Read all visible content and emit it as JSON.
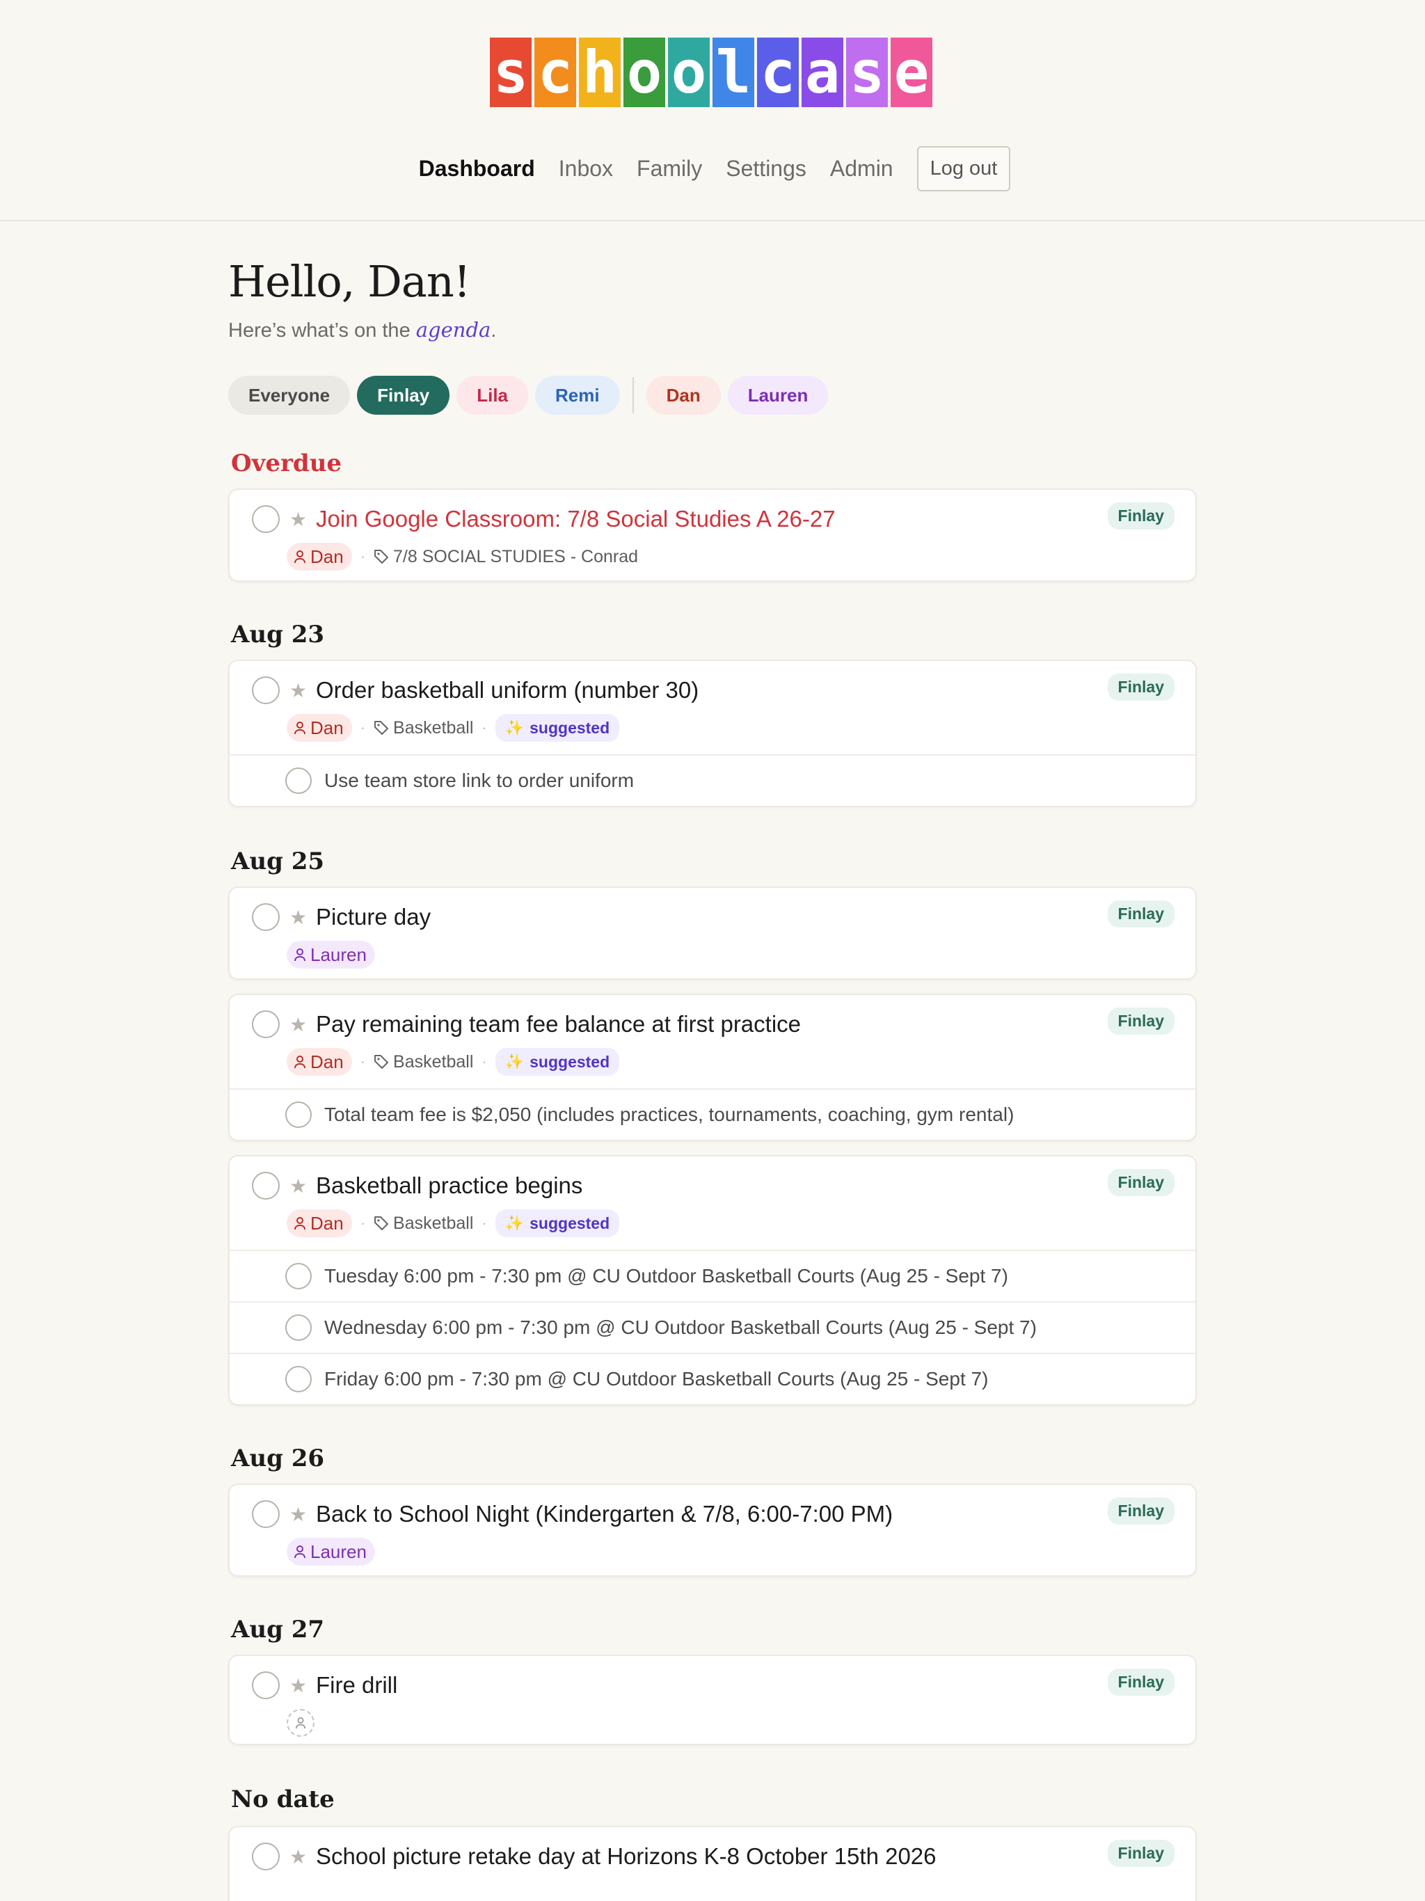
{
  "logo": {
    "letters": [
      "s",
      "c",
      "h",
      "o",
      "o",
      "l",
      "c",
      "a",
      "s",
      "e"
    ],
    "colors": [
      "#e74a32",
      "#f28c1c",
      "#f2b21b",
      "#3a9c3a",
      "#2fa9a0",
      "#3f86e8",
      "#5b5ee8",
      "#8a4ce8",
      "#c06ef0",
      "#f0589a"
    ]
  },
  "nav": {
    "dashboard": "Dashboard",
    "inbox": "Inbox",
    "family": "Family",
    "settings": "Settings",
    "admin": "Admin",
    "logout": "Log out"
  },
  "greeting": {
    "title": "Hello, Dan!",
    "prefix": "Here’s what’s on the ",
    "emphasis": "agenda",
    "suffix": "."
  },
  "filters": {
    "everyone": "Everyone",
    "finlay": "Finlay",
    "lila": "Lila",
    "remi": "Remi",
    "dan": "Dan",
    "lauren": "Lauren",
    "selected": "Finlay"
  },
  "colors": {
    "overdue": "#d1333b",
    "finlay_selected": "#226b5e",
    "accent_purple": "#5b3fd0"
  },
  "sections": {
    "overdue": "Overdue",
    "aug23": "Aug 23",
    "aug25": "Aug 25",
    "aug26": "Aug 26",
    "aug27": "Aug 27",
    "nodate": "No date"
  },
  "tasks": {
    "t1": {
      "title": "Join Google Classroom: 7/8 Social Studies A 26-27",
      "kid": "Finlay",
      "assignee": "Dan",
      "tag": "7/8 SOCIAL STUDIES - Conrad"
    },
    "t2": {
      "title": "Order basketball uniform (number 30)",
      "kid": "Finlay",
      "assignee": "Dan",
      "tag": "Basketball",
      "suggested": "suggested",
      "subtasks": [
        "Use team store link to order uniform"
      ]
    },
    "t3": {
      "title": "Picture day",
      "kid": "Finlay",
      "assignee": "Lauren"
    },
    "t4": {
      "title": "Pay remaining team fee balance at first practice",
      "kid": "Finlay",
      "assignee": "Dan",
      "tag": "Basketball",
      "suggested": "suggested",
      "subtasks": [
        "Total team fee is $2,050 (includes practices, tournaments, coaching, gym rental)"
      ]
    },
    "t5": {
      "title": "Basketball practice begins",
      "kid": "Finlay",
      "assignee": "Dan",
      "tag": "Basketball",
      "suggested": "suggested",
      "subtasks": [
        "Tuesday 6:00 pm - 7:30 pm @ CU Outdoor Basketball Courts (Aug 25 - Sept 7)",
        "Wednesday 6:00 pm - 7:30 pm @ CU Outdoor Basketball Courts (Aug 25 - Sept 7)",
        "Friday 6:00 pm - 7:30 pm @ CU Outdoor Basketball Courts (Aug 25 - Sept 7)"
      ]
    },
    "t6": {
      "title": "Back to School Night (Kindergarten & 7/8, 6:00-7:00 PM)",
      "kid": "Finlay",
      "assignee": "Lauren"
    },
    "t7": {
      "title": "Fire drill",
      "kid": "Finlay"
    },
    "t8": {
      "title": "School picture retake day at Horizons K-8 October 15th 2026",
      "kid": "Finlay"
    }
  }
}
